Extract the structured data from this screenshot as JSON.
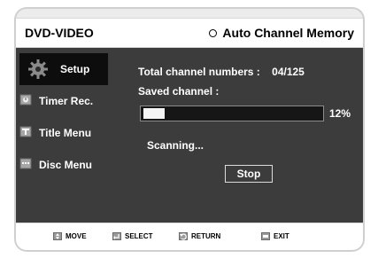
{
  "header": {
    "app_title": "DVD-VIDEO",
    "page_title": "Auto Channel Memory"
  },
  "sidebar": {
    "items": [
      {
        "label": "Setup",
        "icon": "gear-icon",
        "active": true
      },
      {
        "label": "Timer Rec.",
        "icon": "timer-icon",
        "active": false
      },
      {
        "label": "Title Menu",
        "icon": "title-menu-icon",
        "active": false
      },
      {
        "label": "Disc Menu",
        "icon": "disc-menu-icon",
        "active": false
      }
    ]
  },
  "main": {
    "total_channel_label": "Total channel numbers :",
    "total_channel_value": "04/125",
    "saved_channel_label": "Saved channel :",
    "progress_percent": 12,
    "progress_label": "12%",
    "status_text": "Scanning...",
    "stop_label": "Stop"
  },
  "footer": {
    "items": [
      {
        "label": "MOVE",
        "icon": "move-icon"
      },
      {
        "label": "SELECT",
        "icon": "select-icon"
      },
      {
        "label": "RETURN",
        "icon": "return-icon"
      },
      {
        "label": "EXIT",
        "icon": "exit-icon"
      }
    ]
  },
  "colors": {
    "panel": "#3c3c3c",
    "active_item": "#0d0d0d",
    "progress_fill": "#f4f4f4"
  }
}
